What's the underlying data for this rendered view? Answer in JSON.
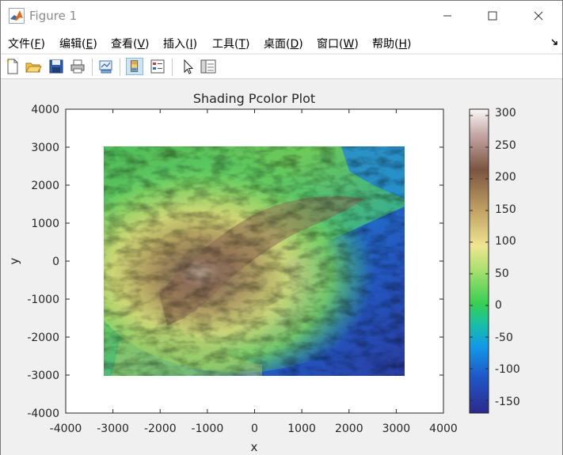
{
  "window": {
    "title": "Figure 1"
  },
  "menu": [
    {
      "label": "文件(",
      "acc": "F",
      "tail": ")"
    },
    {
      "label": "编辑(",
      "acc": "E",
      "tail": ")"
    },
    {
      "label": "查看(",
      "acc": "V",
      "tail": ")"
    },
    {
      "label": "插入(",
      "acc": "I",
      "tail": ")"
    },
    {
      "label": "工具(",
      "acc": "T",
      "tail": ")"
    },
    {
      "label": "桌面(",
      "acc": "D",
      "tail": ")"
    },
    {
      "label": "窗口(",
      "acc": "W",
      "tail": ")"
    },
    {
      "label": "帮助(",
      "acc": "H",
      "tail": ")"
    }
  ],
  "toolbar": {
    "icons": [
      "new-figure-icon",
      "open-file-icon",
      "save-icon",
      "print-icon",
      "link-plot-icon",
      "colorbar-toggle-icon",
      "legend-toggle-icon",
      "edit-plot-icon",
      "property-inspector-icon"
    ]
  },
  "chart_data": {
    "type": "heatmap",
    "title": "Shading Pcolor Plot",
    "xlabel": "x",
    "ylabel": "y",
    "xlim": [
      -4000,
      4000
    ],
    "ylim": [
      -4000,
      4000
    ],
    "xticks": [
      "-4000",
      "-3000",
      "-2000",
      "-1000",
      "0",
      "1000",
      "2000",
      "3000",
      "4000"
    ],
    "yticks": [
      "4000",
      "3000",
      "2000",
      "1000",
      "0",
      "-1000",
      "-2000",
      "-3000",
      "-4000"
    ],
    "data_extent": {
      "x": [
        -3150,
        3150
      ],
      "y": [
        -3000,
        3000
      ]
    },
    "colorbar": {
      "range": [
        -170,
        310
      ],
      "ticks": [
        "300",
        "250",
        "200",
        "150",
        "100",
        "50",
        "0",
        "-50",
        "-100",
        "-150"
      ]
    }
  }
}
